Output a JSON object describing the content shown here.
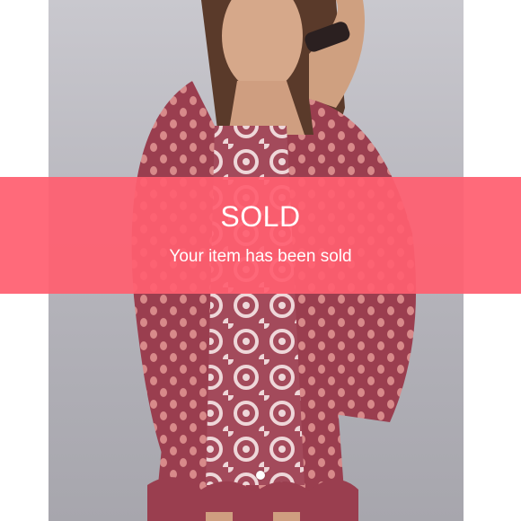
{
  "overlay": {
    "title": "SOLD",
    "subtitle": "Your item has been sold",
    "color": "#ff5f70"
  },
  "photo": {
    "icon": "listing-photo"
  },
  "navigation": {
    "back_icon": "chevron-left-icon"
  },
  "carousel": {
    "total_dots": 1,
    "active_index": 0
  }
}
